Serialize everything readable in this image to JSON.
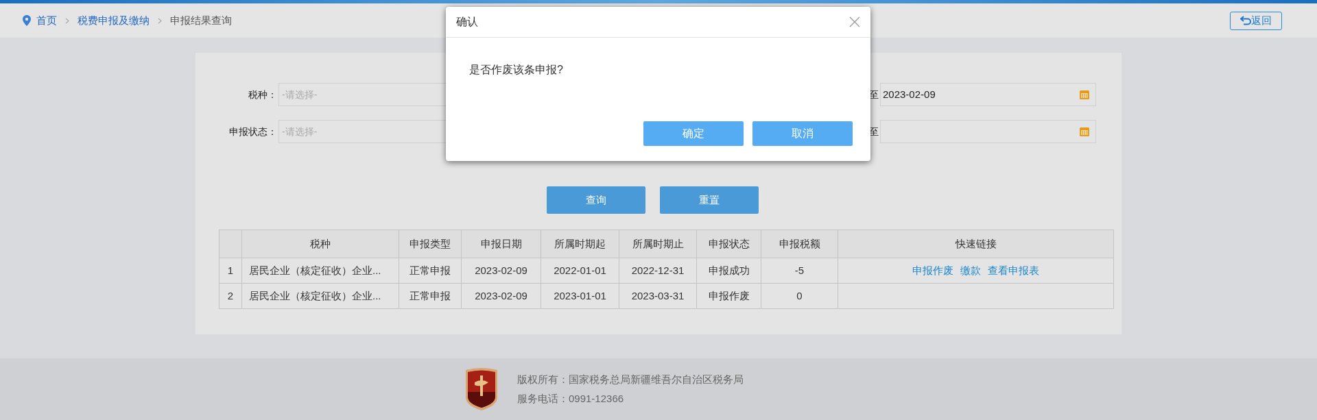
{
  "breadcrumb": [
    {
      "label": "首页",
      "kind": "home"
    },
    {
      "label": "税费申报及缴纳",
      "kind": "link"
    },
    {
      "label": "申报结果查询",
      "kind": "current"
    }
  ],
  "back_button": {
    "label": "返回"
  },
  "form": {
    "left": [
      {
        "label": "税种：",
        "placeholder": "-请选择-"
      },
      {
        "label": "申报状态：",
        "placeholder": "-请选择-"
      }
    ],
    "right": [
      {
        "label": "至",
        "value": "2023-02-09"
      },
      {
        "label": "至"
      }
    ]
  },
  "actions": [
    "查询",
    "重置"
  ],
  "table": {
    "columns": [
      "",
      "税种",
      "申报类型",
      "申报日期",
      "所属时期起",
      "所属时期止",
      "申报状态",
      "申报税额",
      "快速链接"
    ],
    "rows": [
      {
        "cells": [
          "1",
          "居民企业（核定征收）企业...",
          "正常申报",
          "2023-02-09",
          "2022-01-01",
          "2022-12-31",
          "申报成功",
          "-5"
        ],
        "links": [
          "申报作废",
          "缴款",
          "查看申报表"
        ]
      },
      {
        "cells": [
          "2",
          "居民企业（核定征收）企业...",
          "正常申报",
          "2023-02-09",
          "2023-01-01",
          "2023-03-31",
          "申报作废",
          "0"
        ],
        "links": []
      }
    ]
  },
  "footer": {
    "lines": [
      "版权所有：国家税务总局新疆维吾尔自治区税务局",
      "服务电话：0991-12366"
    ]
  },
  "dialog": {
    "title": "确认",
    "message": "是否作废该条申报?",
    "buttons": [
      "确定",
      "取消"
    ]
  }
}
